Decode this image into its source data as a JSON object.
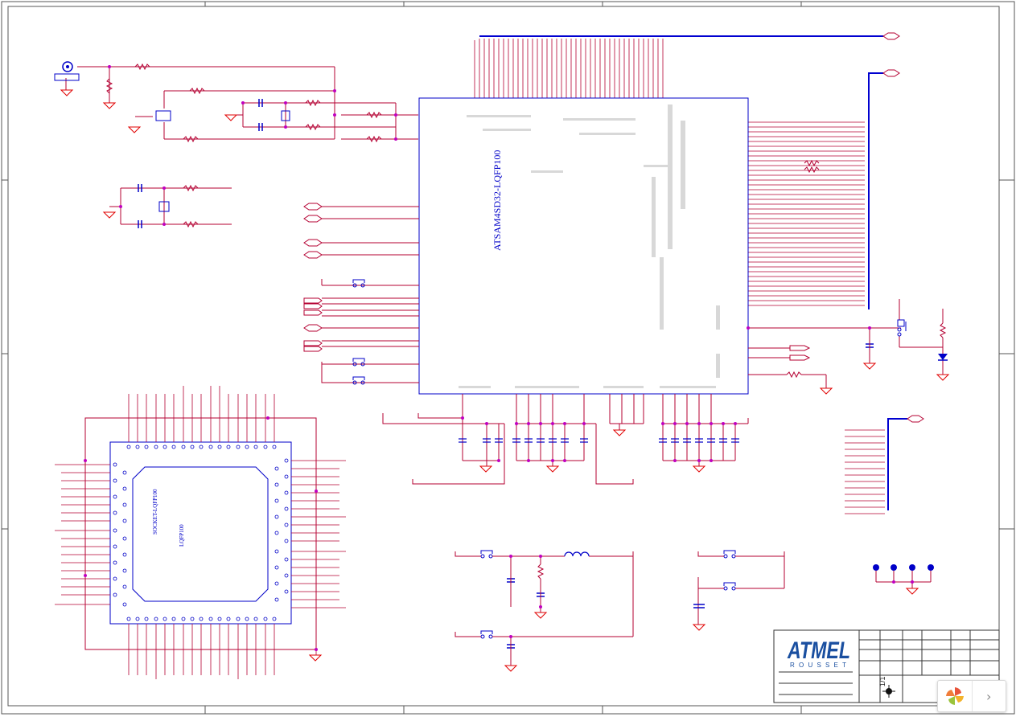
{
  "chip": {
    "part_number": "ATSAM4SD32-LQFP100"
  },
  "socket": {
    "part_number": "SOCKET-LQFP100",
    "footprint_label": "LQFP100"
  },
  "title_block": {
    "logo_text": "ATMEL",
    "location": "ROUSSET",
    "sheet": "1/1"
  },
  "colors": {
    "wire": "#b40032",
    "bus": "#0000d0",
    "body": "#0000c8",
    "junction": "#c000c0",
    "ground": "#e00000"
  },
  "viewer": {
    "logo_icon": "pinwheel-logo-icon",
    "next_label": "›"
  }
}
